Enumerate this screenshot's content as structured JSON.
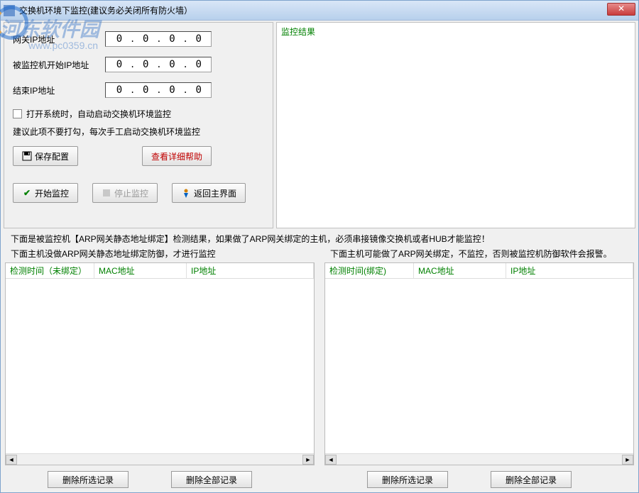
{
  "window": {
    "title": "交换机环境下监控(建议务必关闭所有防火墙）",
    "close_glyph": "✕"
  },
  "watermark": {
    "main": "河东软件园",
    "sub": "www.pc0359.cn"
  },
  "left": {
    "gateway_label": "网关IP地址",
    "start_label": "被监控机开始IP地址",
    "end_label": "结束IP地址",
    "ip_value": [
      "0",
      "0",
      "0",
      "0"
    ],
    "checkbox_label": "打开系统时，自动启动交换机环境监控",
    "hint": "建议此项不要打勾，每次手工启动交换机环境监控",
    "save_button": "保存配置",
    "help_button": "查看详细帮助",
    "start_button": "开始监控",
    "stop_button": "停止监控",
    "return_button": "返回主界面"
  },
  "right": {
    "title": "监控结果"
  },
  "middle": {
    "line1": "下面是被监控机【ARP网关静态地址绑定】检测结果，如果做了ARP网关绑定的主机，必须串接镜像交换机或者HUB才能监控！"
  },
  "tables": {
    "left_caption": "下面主机没做ARP网关静态地址绑定防御，才进行监控",
    "right_caption": "下面主机可能做了ARP网关绑定，不监控，否则被监控机防御软件会报警。",
    "col_time_unbound": "检测时间（未绑定）",
    "col_time_bound": "检测时间(绑定)",
    "col_mac": "MAC地址",
    "col_ip": "IP地址"
  },
  "buttons": {
    "delete_selected": "删除所选记录",
    "delete_all": "删除全部记录"
  }
}
